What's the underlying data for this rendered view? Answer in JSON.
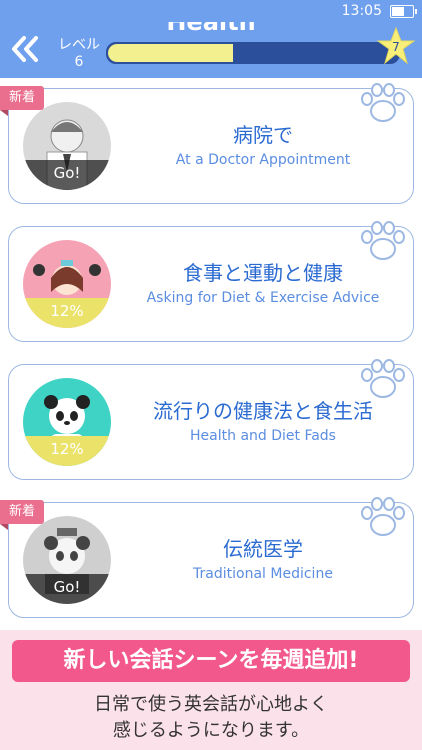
{
  "header": {
    "title": "Health",
    "level_label": "レベル",
    "level_number": "6",
    "progress_fraction": 0.43,
    "star_number": "7"
  },
  "status_bar": {
    "time": "13:05"
  },
  "cards": [
    {
      "jp": "病院で",
      "en": "At a Doctor Appointment",
      "badge": "新着",
      "status": "Go!"
    },
    {
      "jp": "食事と運動と健康",
      "en": "Asking for Diet & Exercise Advice",
      "badge": "",
      "status": "12%"
    },
    {
      "jp": "流行りの健康法と食生活",
      "en": "Health and Diet Fads",
      "badge": "",
      "status": "12%"
    },
    {
      "jp": "伝統医学",
      "en": "Traditional Medicine",
      "badge": "新着",
      "status": "Go!"
    }
  ],
  "promo": {
    "headline": "新しい会話シーンを毎週追加!",
    "line1": "日常で使う英会話が心地よく",
    "line2": "感じるようになります。"
  },
  "colors": {
    "header_blue": "#6fa0ee",
    "progress_dark": "#2c4f9c",
    "progress_fill": "#f3f08f",
    "pink_badge": "#ea6f8e",
    "promo_pink": "#f3588c"
  }
}
